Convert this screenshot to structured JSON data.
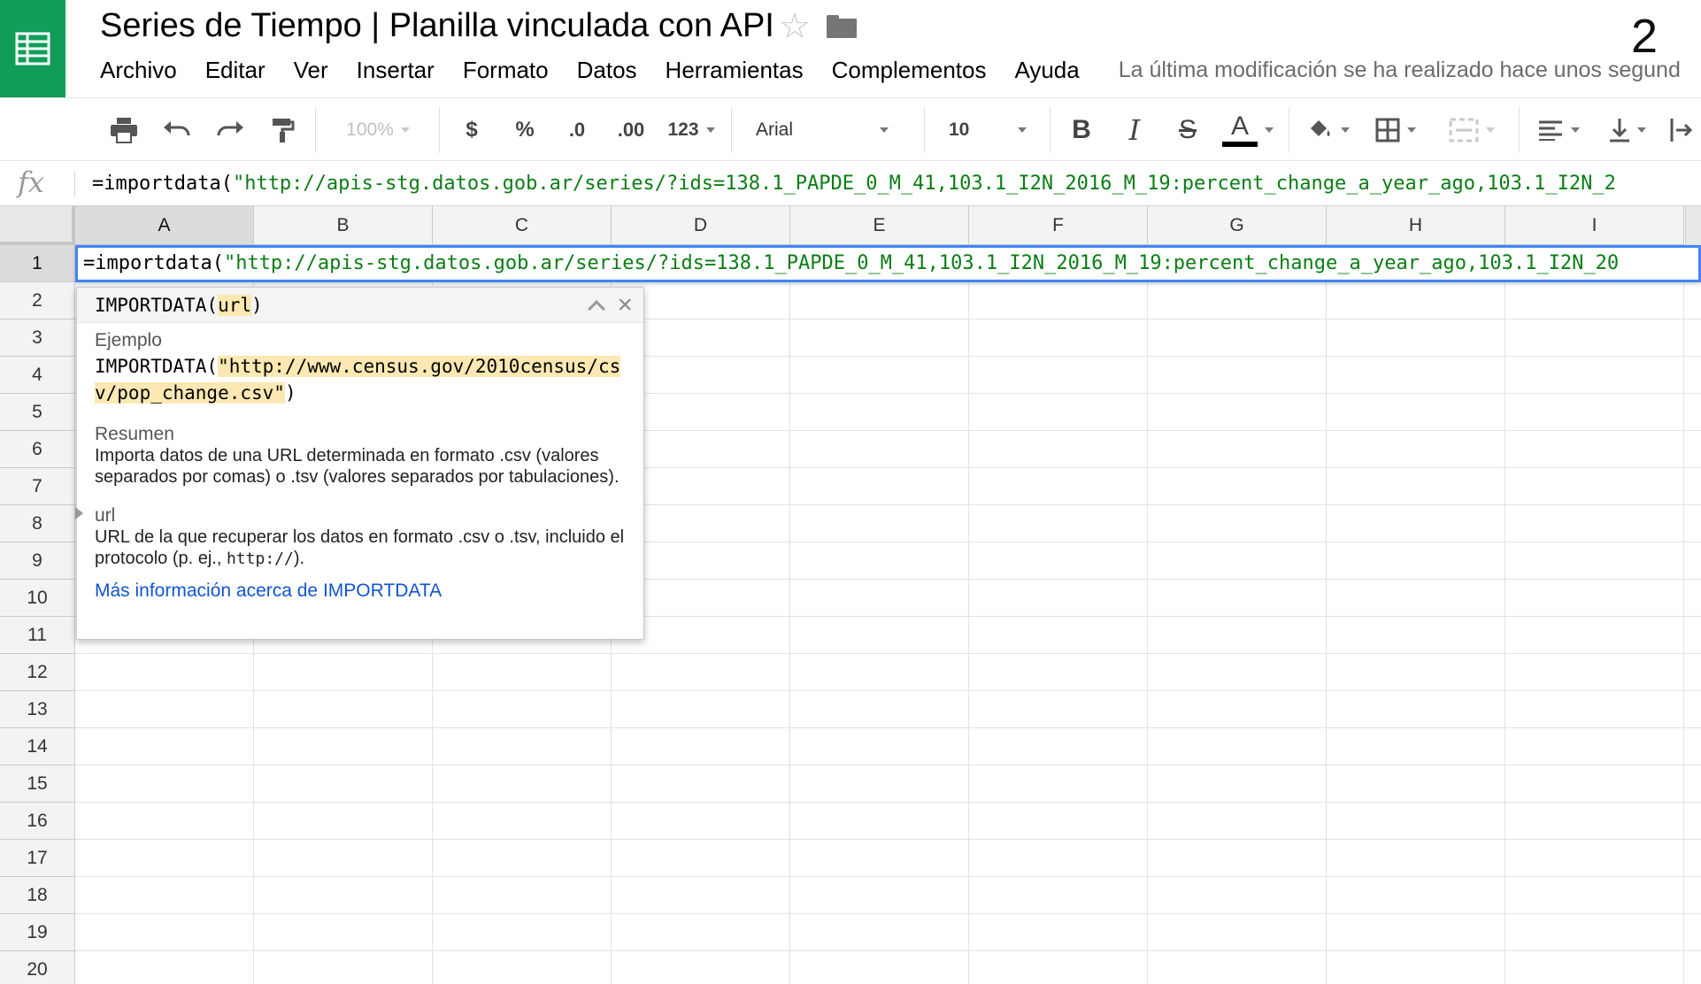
{
  "document": {
    "title": "Series de Tiempo | Planilla vinculada con API",
    "badge": "2"
  },
  "menu": {
    "items": [
      "Archivo",
      "Editar",
      "Ver",
      "Insertar",
      "Formato",
      "Datos",
      "Herramientas",
      "Complementos",
      "Ayuda"
    ],
    "last_edit": "La última modificación se ha realizado hace unos segund"
  },
  "toolbar": {
    "zoom": "100%",
    "currency": "$",
    "percent": "%",
    "decrease_decimals": ".0",
    "increase_decimals": ".00",
    "more_formats": "123",
    "font": "Arial",
    "font_size": "10",
    "bold": "B",
    "italic": "I",
    "strikethrough": "S",
    "text_color_letter": "A"
  },
  "formula_bar": {
    "fx": "fx",
    "prefix": "=importdata(",
    "string": "\"http://apis-stg.datos.gob.ar/series/?ids=138.1_PAPDE_0_M_41,103.1_I2N_2016_M_19:percent_change_a_year_ago,103.1_I2N_2"
  },
  "cell_editor": {
    "prefix": "=importdata(",
    "string": "\"http://apis-stg.datos.gob.ar/series/?ids=138.1_PAPDE_0_M_41,103.1_I2N_2016_M_19:percent_change_a_year_ago,103.1_I2N_20"
  },
  "grid": {
    "columns": [
      "A",
      "B",
      "C",
      "D",
      "E",
      "F",
      "G",
      "H",
      "I"
    ],
    "rows": [
      "1",
      "2",
      "3",
      "4",
      "5",
      "6",
      "7",
      "8",
      "9",
      "10",
      "11",
      "12",
      "13",
      "14",
      "15",
      "16",
      "17",
      "18",
      "19",
      "20"
    ],
    "active_column": "A",
    "active_row": "1"
  },
  "function_help": {
    "name": "IMPORTDATA(",
    "arg": "url",
    "close_paren": ")",
    "example_title": "Ejemplo",
    "example_func": "IMPORTDATA(",
    "example_arg": "\"http://www.census.gov/2010census/csv/pop_change.csv\"",
    "example_close": ")",
    "summary_title": "Resumen",
    "summary_text": "Importa datos de una URL determinada en formato .csv (valores separados por comas) o .tsv (valores separados por tabulaciones).",
    "arg_title": "url",
    "arg_text_1": "URL de la que recuperar los datos en formato .csv o .tsv, incluido el protocolo (p. ej., ",
    "arg_code": "http://",
    "arg_text_2": ").",
    "link": "Más información acerca de IMPORTDATA"
  },
  "colors": {
    "brand": "#0f9d58",
    "selection": "#4285f4",
    "formula_string": "#0a7d14",
    "link": "#1155cc",
    "highlight": "#fce8b2"
  },
  "icons": [
    "sheets-logo-icon",
    "star-icon",
    "folder-icon",
    "print-icon",
    "undo-icon",
    "redo-icon",
    "paint-format-icon",
    "fill-color-icon",
    "borders-icon",
    "merge-cells-icon",
    "align-left-icon",
    "valign-bottom-icon",
    "wrap-text-icon",
    "collapse-icon",
    "close-icon"
  ]
}
